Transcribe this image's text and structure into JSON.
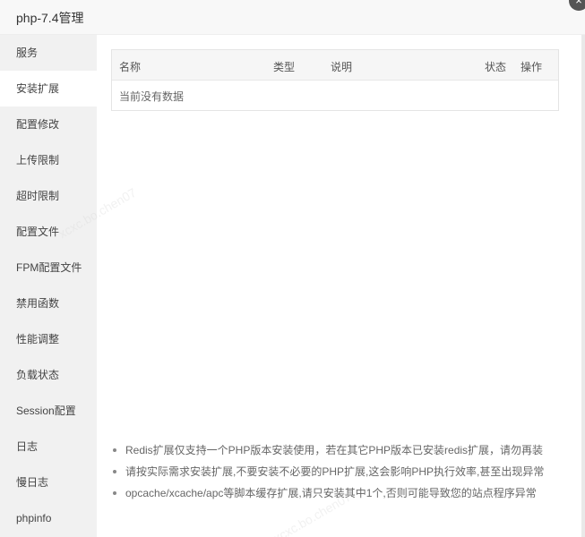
{
  "window": {
    "title": "php-7.4管理",
    "close_icon": "×"
  },
  "sidebar": {
    "items": [
      {
        "label": "服务"
      },
      {
        "label": "安装扩展"
      },
      {
        "label": "配置修改"
      },
      {
        "label": "上传限制"
      },
      {
        "label": "超时限制"
      },
      {
        "label": "配置文件"
      },
      {
        "label": "FPM配置文件"
      },
      {
        "label": "禁用函数"
      },
      {
        "label": "性能调整"
      },
      {
        "label": "负载状态"
      },
      {
        "label": "Session配置"
      },
      {
        "label": "日志"
      },
      {
        "label": "慢日志"
      },
      {
        "label": "phpinfo"
      }
    ],
    "active_index": 1
  },
  "table": {
    "headers": {
      "name": "名称",
      "type": "类型",
      "desc": "说明",
      "status": "状态",
      "action": "操作"
    },
    "empty_text": "当前没有数据"
  },
  "notes": [
    "Redis扩展仅支持一个PHP版本安装使用，若在其它PHP版本已安装redis扩展，请勿再装",
    "请按实际需求安装扩展,不要安装不必要的PHP扩展,这会影响PHP执行效率,甚至出现异常",
    "opcache/xcache/apc等脚本缓存扩展,请只安装其中1个,否则可能导致您的站点程序异常"
  ],
  "watermark": "xcxc.bo.chen07"
}
